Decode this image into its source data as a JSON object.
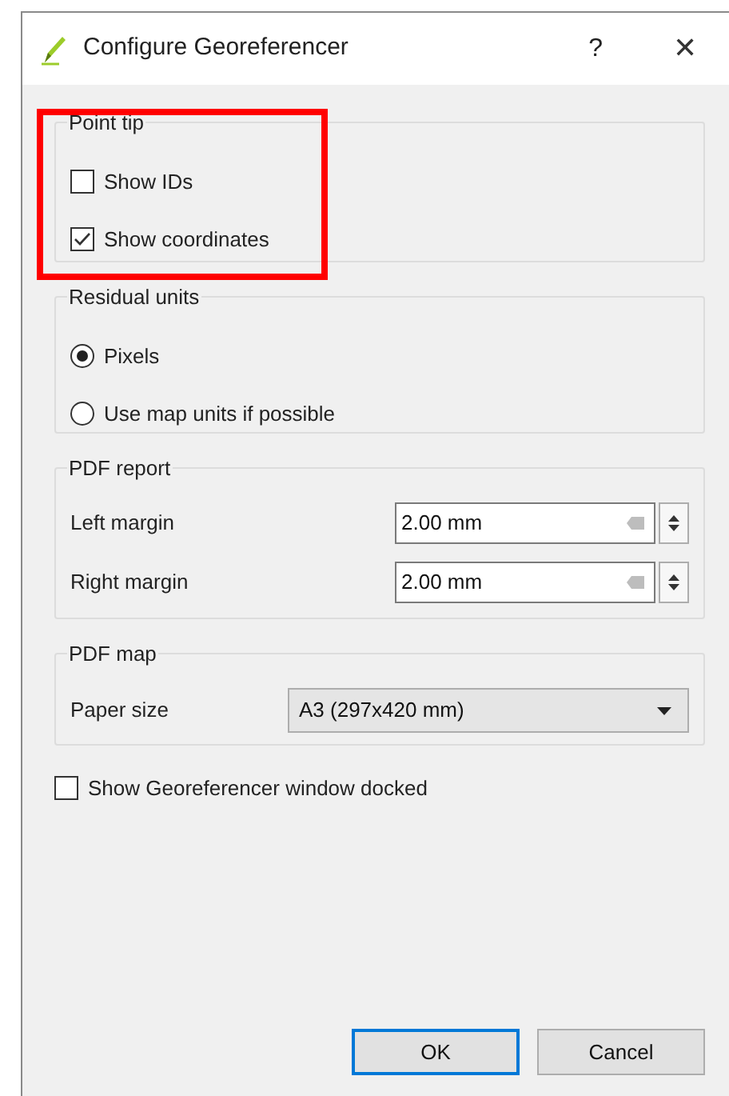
{
  "window": {
    "title": "Configure Georeferencer",
    "help": "?",
    "close": "✕"
  },
  "point_tip": {
    "title": "Point tip",
    "highlighted": true,
    "options": [
      {
        "label": "Show IDs",
        "checked": false
      },
      {
        "label": "Show coordinates",
        "checked": true
      }
    ]
  },
  "residual_units": {
    "title": "Residual units",
    "options": [
      {
        "label": "Pixels",
        "selected": true
      },
      {
        "label": "Use map units if possible",
        "selected": false
      }
    ]
  },
  "pdf_report": {
    "title": "PDF report",
    "fields": [
      {
        "label": "Left margin",
        "value": "2.00 mm"
      },
      {
        "label": "Right margin",
        "value": "2.00 mm"
      }
    ]
  },
  "pdf_map": {
    "title": "PDF map",
    "label": "Paper size",
    "value": "A3 (297x420 mm)"
  },
  "docked": {
    "label": "Show Georeferencer window docked",
    "checked": false
  },
  "buttons": [
    {
      "label": "OK",
      "default": true
    },
    {
      "label": "Cancel",
      "default": false
    }
  ]
}
